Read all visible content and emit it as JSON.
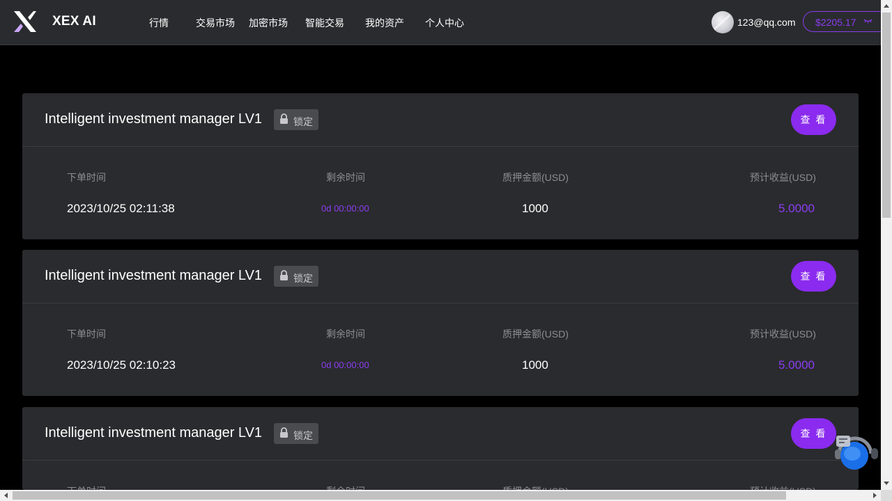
{
  "header": {
    "brand": "XEX AI",
    "nav": [
      "行情",
      "交易市场",
      "加密市场",
      "智能交易",
      "我的资产",
      "个人中心"
    ],
    "user_email": "123@qq.com",
    "balance": "$2205.17"
  },
  "cards": [
    {
      "title": "Intelligent investment manager LV1",
      "status": "锁定",
      "view_label": "查 看",
      "labels": [
        "下单时间",
        "剩余时间",
        "质押金额(USD)",
        "预计收益(USD)"
      ],
      "order_time": "2023/10/25 02:11:38",
      "remaining": "0d 00:00:00",
      "amount": "1000",
      "profit": "5.0000"
    },
    {
      "title": "Intelligent investment manager LV1",
      "status": "锁定",
      "view_label": "查 看",
      "labels": [
        "下单时间",
        "剩余时间",
        "质押金额(USD)",
        "预计收益(USD)"
      ],
      "order_time": "2023/10/25 02:10:23",
      "remaining": "0d 00:00:00",
      "amount": "1000",
      "profit": "5.0000"
    },
    {
      "title": "Intelligent investment manager LV1",
      "status": "锁定",
      "view_label": "查 看",
      "labels": [
        "下单时间",
        "剩余时间",
        "质押金额(USD)",
        "预计收益(USD)"
      ]
    }
  ],
  "colors": {
    "accent": "#8a2bef",
    "panel": "#2a2b2e",
    "background": "#000000"
  },
  "icons": [
    "xex-logo-icon",
    "avatar-icon",
    "eye-closed-icon",
    "lock-icon",
    "customer-service-icon"
  ]
}
